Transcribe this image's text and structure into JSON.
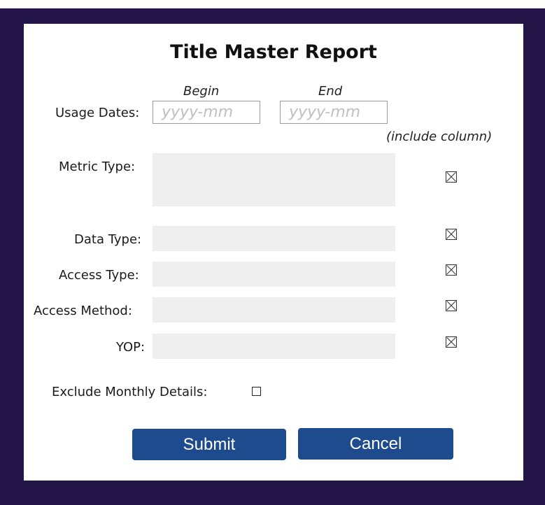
{
  "form": {
    "title": "Title Master Report",
    "columns": {
      "begin": "Begin",
      "end": "End"
    },
    "usage_dates": {
      "label": "Usage Dates:",
      "begin_placeholder": "yyyy-mm",
      "end_placeholder": "yyyy-mm",
      "note": "(include column)"
    },
    "fields": {
      "metric_type": "Metric Type:",
      "data_type": "Data Type:",
      "access_type": "Access Type:",
      "access_method": "Access Method:",
      "yop": "YOP:"
    },
    "include_columns": {
      "metric_type": true,
      "data_type": true,
      "access_type": true,
      "access_method": true,
      "yop": true
    },
    "exclude_monthly": {
      "label": "Exclude Monthly Details:",
      "checked": false
    },
    "buttons": {
      "submit": "Submit",
      "cancel": "Cancel"
    },
    "colors": {
      "frame": "#241548",
      "button": "#1e4b8e",
      "field_bg": "#efefef"
    }
  }
}
